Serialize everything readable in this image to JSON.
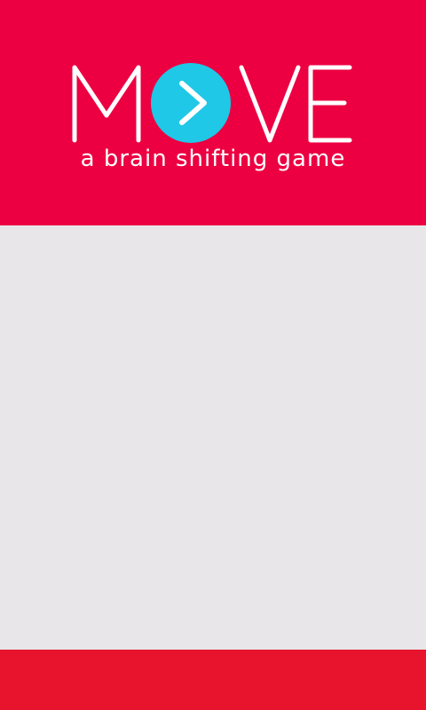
{
  "app": {
    "title_letters": [
      "M",
      "V",
      "E"
    ],
    "subtitle": "a brain shifting game"
  },
  "colors": {
    "header": "#ec0042",
    "background": "#e8e6e9",
    "footer": "#e8132c",
    "logo_circle": "#1ec8e6",
    "logo_text": "#ffffff"
  },
  "icons": {
    "logo_o": "chevron-right-icon"
  }
}
